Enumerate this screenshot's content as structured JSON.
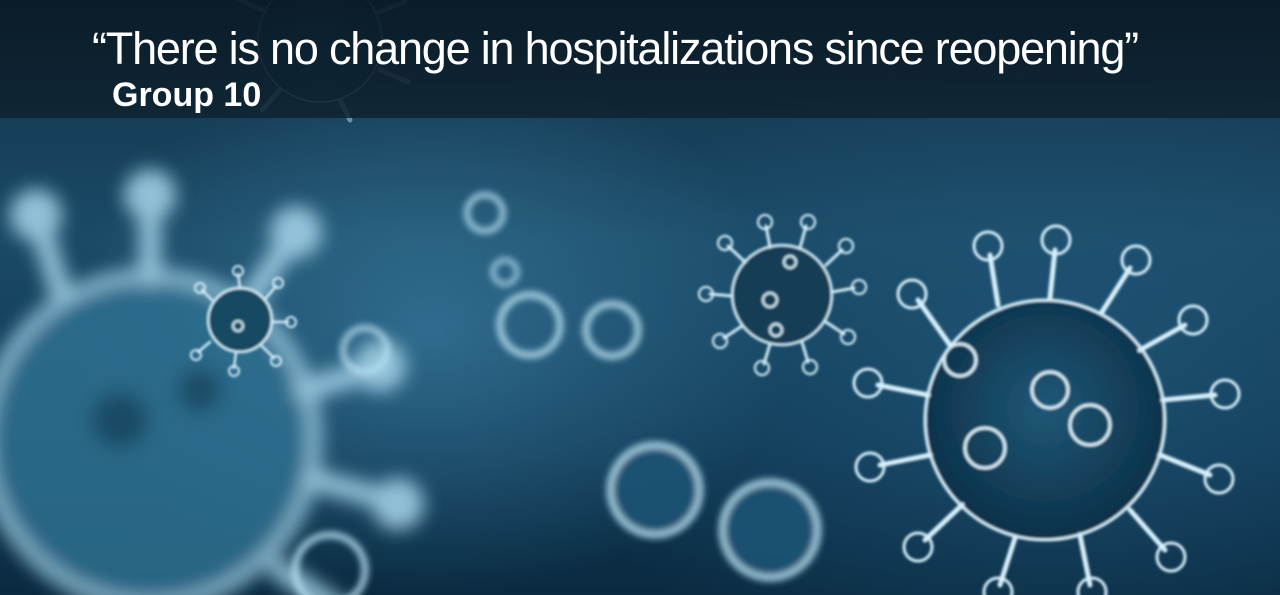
{
  "slide": {
    "headline": "“There is no change in hospitalizations since reopening”",
    "subtitle": "Group 10"
  },
  "colors": {
    "background": "#1a4a66",
    "title_band": "#0e2230",
    "virus_outline": "#cfeaf7",
    "text": "#ffffff"
  },
  "icons": [
    "virus-particle-icon"
  ]
}
